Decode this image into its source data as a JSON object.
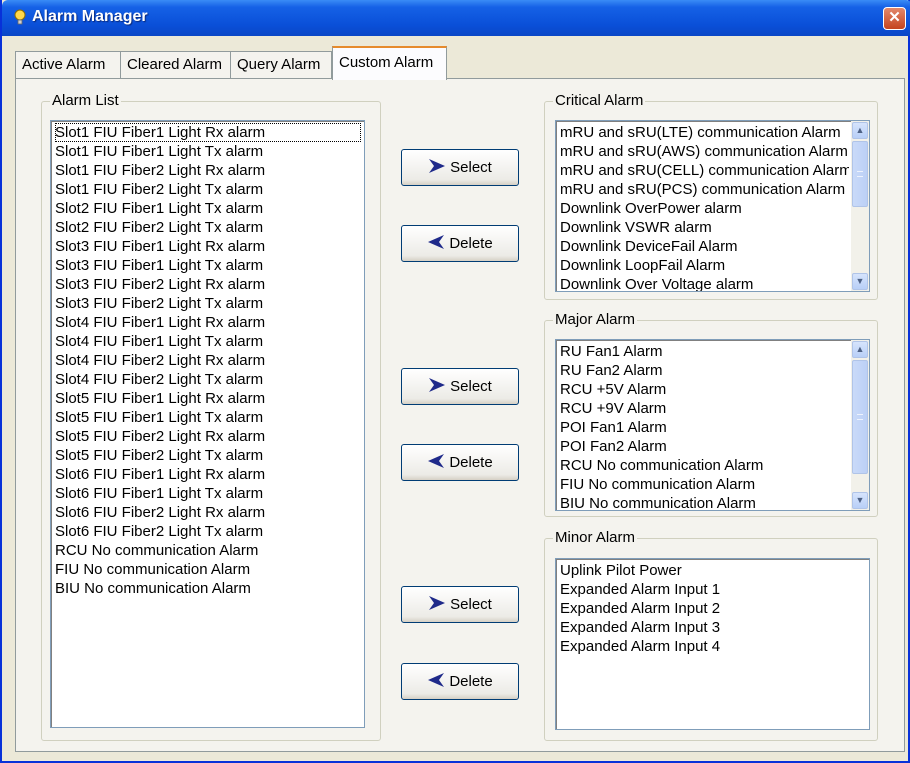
{
  "window": {
    "title": "Alarm Manager",
    "close_symbol": "✕"
  },
  "tabs": [
    {
      "label": "Active Alarm"
    },
    {
      "label": "Cleared Alarm"
    },
    {
      "label": "Query Alarm"
    },
    {
      "label": "Custom Alarm",
      "active": true
    }
  ],
  "alarm_list": {
    "title": "Alarm List",
    "items": [
      "Slot1 FIU Fiber1 Light Rx alarm",
      "Slot1 FIU Fiber1 Light Tx alarm",
      "Slot1 FIU Fiber2 Light Rx alarm",
      "Slot1 FIU Fiber2 Light Tx alarm",
      "Slot2 FIU Fiber1 Light Tx alarm",
      "Slot2 FIU Fiber2 Light Tx alarm",
      "Slot3 FIU Fiber1 Light Rx alarm",
      "Slot3 FIU Fiber1 Light Tx alarm",
      "Slot3 FIU Fiber2 Light Rx alarm",
      "Slot3 FIU Fiber2 Light Tx alarm",
      "Slot4 FIU Fiber1 Light Rx alarm",
      "Slot4 FIU Fiber1 Light Tx alarm",
      "Slot4 FIU Fiber2 Light Rx alarm",
      "Slot4 FIU Fiber2 Light Tx alarm",
      "Slot5 FIU Fiber1 Light Rx alarm",
      "Slot5 FIU Fiber1 Light Tx alarm",
      "Slot5 FIU Fiber2 Light Rx alarm",
      "Slot5 FIU Fiber2 Light Tx alarm",
      "Slot6 FIU Fiber1 Light Rx alarm",
      "Slot6 FIU Fiber1 Light Tx alarm",
      "Slot6 FIU Fiber2 Light Rx alarm",
      "Slot6 FIU Fiber2 Light Tx alarm",
      "RCU No communication Alarm",
      "FIU No communication Alarm",
      "BIU No communication Alarm"
    ]
  },
  "buttons": {
    "select_label": "Select",
    "delete_label": "Delete"
  },
  "critical": {
    "title": "Critical Alarm",
    "items": [
      "mRU and sRU(LTE) communication Alarm",
      "mRU and sRU(AWS) communication Alarm",
      "mRU and sRU(CELL) communication Alarm",
      "mRU and sRU(PCS) communication Alarm",
      "Downlink OverPower alarm",
      "Downlink VSWR alarm",
      "Downlink DeviceFail Alarm",
      "Downlink LoopFail Alarm",
      "Downlink Over Voltage alarm"
    ]
  },
  "major": {
    "title": "Major Alarm",
    "items": [
      "RU Fan1 Alarm",
      "RU Fan2 Alarm",
      "RCU +5V Alarm",
      "RCU +9V Alarm",
      "POI Fan1 Alarm",
      "POI Fan2 Alarm",
      "RCU No communication Alarm",
      "FIU No communication Alarm",
      "BIU No communication Alarm"
    ]
  },
  "minor": {
    "title": "Minor Alarm",
    "items": [
      "Uplink Pilot Power",
      "Expanded Alarm Input 1",
      "Expanded Alarm Input 2",
      "Expanded Alarm Input 3",
      "Expanded Alarm Input 4"
    ]
  },
  "colors": {
    "accent": "#0a4fd8",
    "arrow": "#1f2a8a",
    "tab_highlight": "#e68b2c"
  },
  "icons": {
    "title_icon": "lightbulb-icon",
    "select_icon": "arrow-right-icon",
    "delete_icon": "arrow-left-icon"
  }
}
